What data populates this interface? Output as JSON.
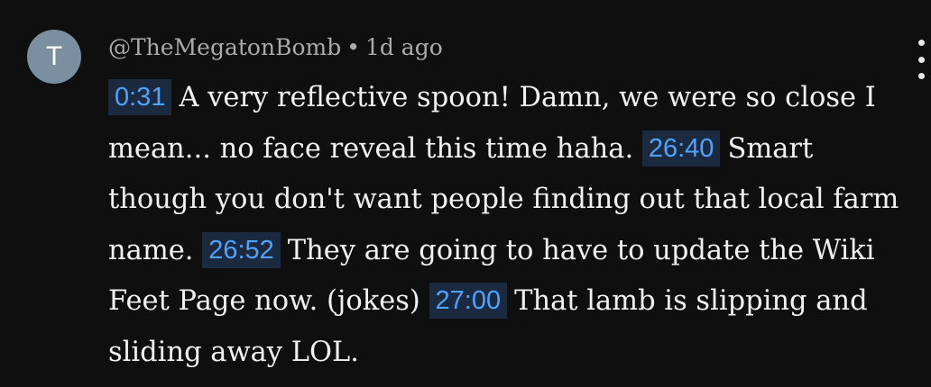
{
  "comment": {
    "avatar_letter": "T",
    "username": "@TheMegatonBomb",
    "separator": "•",
    "time_ago": "1d ago",
    "segments": [
      {
        "timestamp": "0:31",
        "text": "A very reflective spoon! Damn, we were so close I mean... no face reveal this time haha. "
      },
      {
        "timestamp": "26:40",
        "text": "Smart though you don't want people finding out that local farm name. "
      },
      {
        "timestamp": "26:52",
        "text": "They are going to have to update the Wiki Feet Page now. (jokes) "
      },
      {
        "timestamp": "27:00",
        "text": "That lamb is slipping and sliding away LOL."
      }
    ]
  },
  "colors": {
    "background": "#0f0f0f",
    "avatar": "#7a8fa0",
    "timestamp_text": "#4ea3ff",
    "timestamp_bg": "#1c2a3f"
  },
  "icons": {
    "menu": "more-vert-icon"
  }
}
